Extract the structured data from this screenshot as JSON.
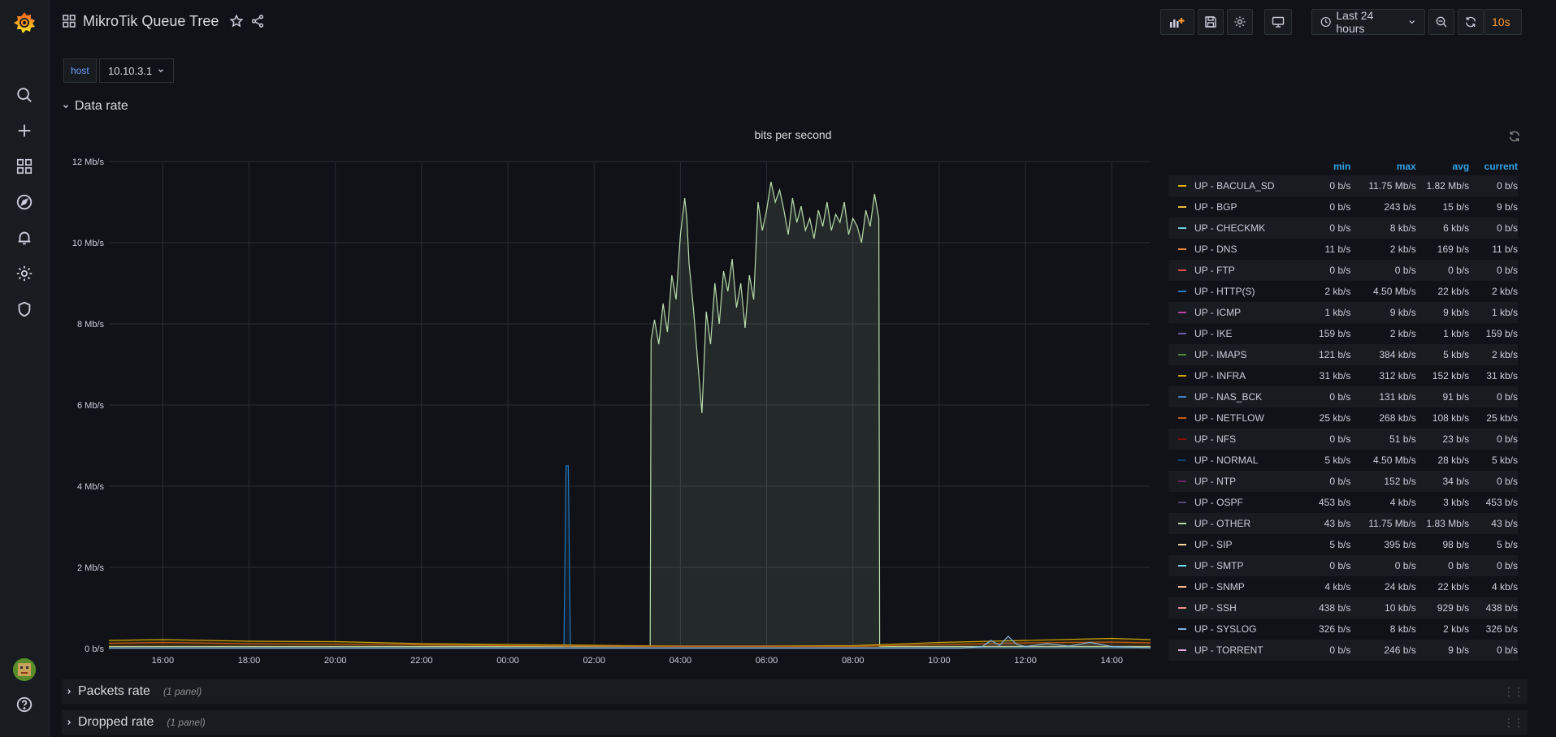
{
  "dashboard": {
    "title": "MikroTik Queue Tree"
  },
  "toolbar": {
    "time_range": "Last 24 hours",
    "refresh_interval": "10s"
  },
  "variables": {
    "host_label": "host",
    "host_value": "10.10.3.1"
  },
  "rows": [
    {
      "title": "Data rate",
      "panel_count": ""
    },
    {
      "title": "Packets rate",
      "panel_count": "(1 panel)"
    },
    {
      "title": "Dropped rate",
      "panel_count": "(1 panel)"
    }
  ],
  "panel": {
    "title": "bits per second"
  },
  "legend": {
    "headers": {
      "min": "min",
      "max": "max",
      "avg": "avg",
      "current": "current"
    },
    "series": [
      {
        "name": "UP - BACULA_SD",
        "color": "#e0b400",
        "min": "0 b/s",
        "max": "11.75 Mb/s",
        "avg": "1.82 Mb/s",
        "current": "0 b/s"
      },
      {
        "name": "UP - BGP",
        "color": "#eab839",
        "min": "0 b/s",
        "max": "243 b/s",
        "avg": "15 b/s",
        "current": "9 b/s"
      },
      {
        "name": "UP - CHECKMK",
        "color": "#6ed0e0",
        "min": "0 b/s",
        "max": "8 kb/s",
        "avg": "6 kb/s",
        "current": "0 b/s"
      },
      {
        "name": "UP - DNS",
        "color": "#ef843c",
        "min": "11 b/s",
        "max": "2 kb/s",
        "avg": "169 b/s",
        "current": "11 b/s"
      },
      {
        "name": "UP - FTP",
        "color": "#e24d42",
        "min": "0 b/s",
        "max": "0 b/s",
        "avg": "0 b/s",
        "current": "0 b/s"
      },
      {
        "name": "UP - HTTP(S)",
        "color": "#1f78c1",
        "min": "2 kb/s",
        "max": "4.50 Mb/s",
        "avg": "22 kb/s",
        "current": "2 kb/s"
      },
      {
        "name": "UP - ICMP",
        "color": "#ba43a9",
        "min": "1 kb/s",
        "max": "9 kb/s",
        "avg": "9 kb/s",
        "current": "1 kb/s"
      },
      {
        "name": "UP - IKE",
        "color": "#705da0",
        "min": "159 b/s",
        "max": "2 kb/s",
        "avg": "1 kb/s",
        "current": "159 b/s"
      },
      {
        "name": "UP - IMAPS",
        "color": "#508642",
        "min": "121 b/s",
        "max": "384 kb/s",
        "avg": "5 kb/s",
        "current": "2 kb/s"
      },
      {
        "name": "UP - INFRA",
        "color": "#cca300",
        "min": "31 kb/s",
        "max": "312 kb/s",
        "avg": "152 kb/s",
        "current": "31 kb/s"
      },
      {
        "name": "UP - NAS_BCK",
        "color": "#447ebc",
        "min": "0 b/s",
        "max": "131 kb/s",
        "avg": "91 b/s",
        "current": "0 b/s"
      },
      {
        "name": "UP - NETFLOW",
        "color": "#c15c17",
        "min": "25 kb/s",
        "max": "268 kb/s",
        "avg": "108 kb/s",
        "current": "25 kb/s"
      },
      {
        "name": "UP - NFS",
        "color": "#890f02",
        "min": "0 b/s",
        "max": "51 b/s",
        "avg": "23 b/s",
        "current": "0 b/s"
      },
      {
        "name": "UP - NORMAL",
        "color": "#0a437c",
        "min": "5 kb/s",
        "max": "4.50 Mb/s",
        "avg": "28 kb/s",
        "current": "5 kb/s"
      },
      {
        "name": "UP - NTP",
        "color": "#6d1f62",
        "min": "0 b/s",
        "max": "152 b/s",
        "avg": "34 b/s",
        "current": "0 b/s"
      },
      {
        "name": "UP - OSPF",
        "color": "#584477",
        "min": "453 b/s",
        "max": "4 kb/s",
        "avg": "3 kb/s",
        "current": "453 b/s"
      },
      {
        "name": "UP - OTHER",
        "color": "#b7dbab",
        "min": "43 b/s",
        "max": "11.75 Mb/s",
        "avg": "1.83 Mb/s",
        "current": "43 b/s"
      },
      {
        "name": "UP - SIP",
        "color": "#f4d598",
        "min": "5 b/s",
        "max": "395 b/s",
        "avg": "98 b/s",
        "current": "5 b/s"
      },
      {
        "name": "UP - SMTP",
        "color": "#70dbed",
        "min": "0 b/s",
        "max": "0 b/s",
        "avg": "0 b/s",
        "current": "0 b/s"
      },
      {
        "name": "UP - SNMP",
        "color": "#f9ba8f",
        "min": "4 kb/s",
        "max": "24 kb/s",
        "avg": "22 kb/s",
        "current": "4 kb/s"
      },
      {
        "name": "UP - SSH",
        "color": "#f29191",
        "min": "438 b/s",
        "max": "10 kb/s",
        "avg": "929 b/s",
        "current": "438 b/s"
      },
      {
        "name": "UP - SYSLOG",
        "color": "#82b5d8",
        "min": "326 b/s",
        "max": "8 kb/s",
        "avg": "2 kb/s",
        "current": "326 b/s"
      },
      {
        "name": "UP - TORRENT",
        "color": "#e5a8e2",
        "min": "0 b/s",
        "max": "246 b/s",
        "avg": "9 b/s",
        "current": "0 b/s"
      }
    ]
  },
  "chart_data": {
    "type": "area",
    "title": "bits per second",
    "y_ticks": [
      "0 b/s",
      "2 Mb/s",
      "4 Mb/s",
      "6 Mb/s",
      "8 Mb/s",
      "10 Mb/s",
      "12 Mb/s"
    ],
    "x_ticks": [
      "16:00",
      "18:00",
      "20:00",
      "22:00",
      "00:00",
      "02:00",
      "04:00",
      "06:00",
      "08:00",
      "10:00",
      "12:00",
      "14:00"
    ],
    "ylim": [
      0,
      12
    ],
    "y_unit": "Mb/s",
    "x_unit": "hours",
    "xlim": [
      14.75,
      38.9
    ],
    "grid": true,
    "series": [
      {
        "name": "UP - OTHER",
        "color": "#b7dbab",
        "x": [
          14.75,
          26.5,
          27.3,
          27.32,
          27.4,
          27.5,
          27.6,
          27.7,
          27.8,
          27.9,
          28.0,
          28.1,
          28.15,
          28.2,
          28.3,
          28.4,
          28.5,
          28.6,
          28.7,
          28.8,
          28.9,
          29.0,
          29.1,
          29.2,
          29.3,
          29.4,
          29.5,
          29.6,
          29.7,
          29.8,
          29.9,
          30.0,
          30.1,
          30.2,
          30.3,
          30.4,
          30.5,
          30.6,
          30.7,
          30.8,
          30.9,
          31.0,
          31.1,
          31.2,
          31.3,
          31.4,
          31.5,
          31.6,
          31.7,
          31.8,
          31.9,
          32.0,
          32.1,
          32.2,
          32.3,
          32.4,
          32.5,
          32.6,
          32.62,
          32.7,
          38.9
        ],
        "values": [
          0.05,
          0.05,
          0.05,
          7.6,
          8.1,
          7.5,
          8.5,
          7.8,
          9.2,
          8.6,
          10.2,
          11.1,
          10.6,
          9.5,
          8.4,
          7.1,
          5.8,
          8.3,
          7.5,
          9.0,
          8.0,
          9.3,
          8.8,
          9.6,
          8.4,
          9.0,
          7.9,
          9.2,
          8.6,
          11.0,
          10.3,
          10.8,
          11.5,
          11.0,
          11.3,
          10.8,
          10.2,
          11.1,
          10.5,
          10.9,
          10.3,
          10.6,
          10.1,
          10.8,
          10.4,
          11.0,
          10.3,
          10.7,
          10.5,
          11.0,
          10.2,
          10.6,
          10.4,
          10.0,
          10.8,
          10.4,
          11.2,
          10.6,
          0.05,
          0.05,
          0.05
        ]
      },
      {
        "name": "UP - HTTP(S)",
        "color": "#1f78c1",
        "x": [
          14.75,
          25.3,
          25.35,
          25.4,
          25.45,
          38.9
        ],
        "values": [
          0.02,
          0.02,
          4.5,
          4.5,
          0.02,
          0.02
        ]
      },
      {
        "name": "UP - INFRA",
        "color": "#cca300",
        "x": [
          14.75,
          16,
          18,
          20,
          22,
          24,
          26,
          28,
          30,
          32,
          34,
          36,
          38,
          38.9
        ],
        "values": [
          0.2,
          0.22,
          0.18,
          0.17,
          0.12,
          0.1,
          0.08,
          0.06,
          0.06,
          0.07,
          0.15,
          0.2,
          0.25,
          0.22
        ]
      },
      {
        "name": "UP - NETFLOW",
        "color": "#c15c17",
        "x": [
          14.75,
          16,
          18,
          20,
          22,
          24,
          26,
          28,
          30,
          32,
          34,
          36,
          38,
          38.9
        ],
        "values": [
          0.13,
          0.15,
          0.12,
          0.11,
          0.09,
          0.07,
          0.06,
          0.05,
          0.05,
          0.05,
          0.1,
          0.14,
          0.16,
          0.14
        ]
      },
      {
        "name": "UP - SYSLOG",
        "color": "#82b5d8",
        "x": [
          14.75,
          34.5,
          35.0,
          35.2,
          35.4,
          35.6,
          35.8,
          36.0,
          36.5,
          37.0,
          37.5,
          38.0,
          38.9
        ],
        "values": [
          0.01,
          0.01,
          0.05,
          0.2,
          0.08,
          0.3,
          0.1,
          0.05,
          0.12,
          0.06,
          0.15,
          0.05,
          0.02
        ]
      }
    ]
  }
}
